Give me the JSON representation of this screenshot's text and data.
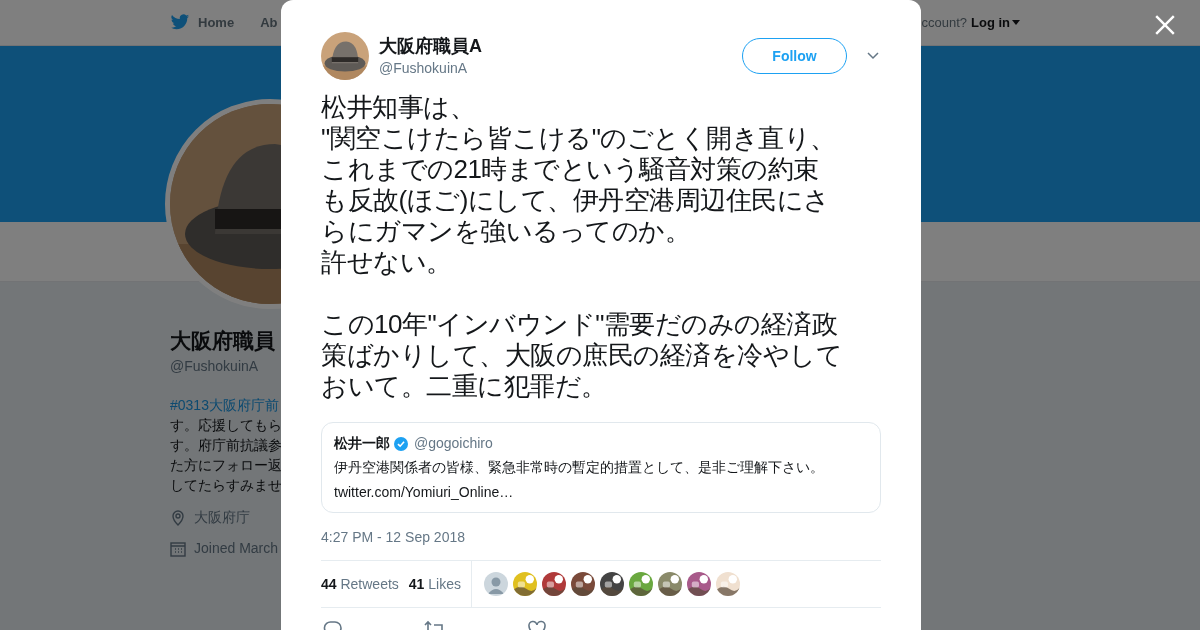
{
  "background_page": {
    "nav": {
      "home": "Home",
      "about": "Ab",
      "account_prompt": "ccount?",
      "login": "Log in"
    },
    "profile": {
      "name": "大阪府職員",
      "handle": "@FushokuinA",
      "bio_lines": [
        "#0313大阪府庁前",
        "す。応援してもら",
        "す。府庁前抗議参",
        "た方にフォロー返",
        "してたらすみませ"
      ],
      "location": "大阪府庁",
      "joined": "Joined March"
    }
  },
  "tweet": {
    "author": {
      "name": "大阪府職員A",
      "handle": "@FushokuinA"
    },
    "follow_button": "Follow",
    "paragraphs": [
      [
        "松井知事は、",
        "\"関空こけたら皆こける\"のごとく開き直り、",
        "これまでの21時までという騒音対策の約束",
        "も反故(ほご)にして、伊丹空港周辺住民にさ",
        "らにガマンを強いるってのか。",
        "許せない。"
      ],
      [
        "この10年\"インバウンド\"需要だのみの経済政",
        "策ばかりして、大阪の庶民の経済を冷やして",
        "おいて。二重に犯罪だ。"
      ]
    ],
    "quoted": {
      "name": "松井一郎",
      "verified": true,
      "handle": "@gogoichiro",
      "text": "伊丹空港関係者の皆様、緊急非常時の暫定的措置として、是非ご理解下さい。",
      "link": "twitter.com/Yomiuri_Online…"
    },
    "timestamp": "4:27 PM - 12 Sep 2018",
    "stats": [
      {
        "count": "44",
        "label": "Retweets"
      },
      {
        "count": "41",
        "label": "Likes"
      }
    ],
    "likers": [
      {
        "kind": "default"
      },
      {
        "kind": "picture",
        "color": "#e0c020"
      },
      {
        "kind": "picture",
        "color": "#b03a3a"
      },
      {
        "kind": "picture",
        "color": "#7a4a3a"
      },
      {
        "kind": "picture",
        "color": "#444444"
      },
      {
        "kind": "picture",
        "color": "#6aa840"
      },
      {
        "kind": "picture",
        "color": "#8a8a6a"
      },
      {
        "kind": "picture",
        "color": "#a85a8a"
      },
      {
        "kind": "picture",
        "color": "#f0e0d0"
      }
    ]
  }
}
